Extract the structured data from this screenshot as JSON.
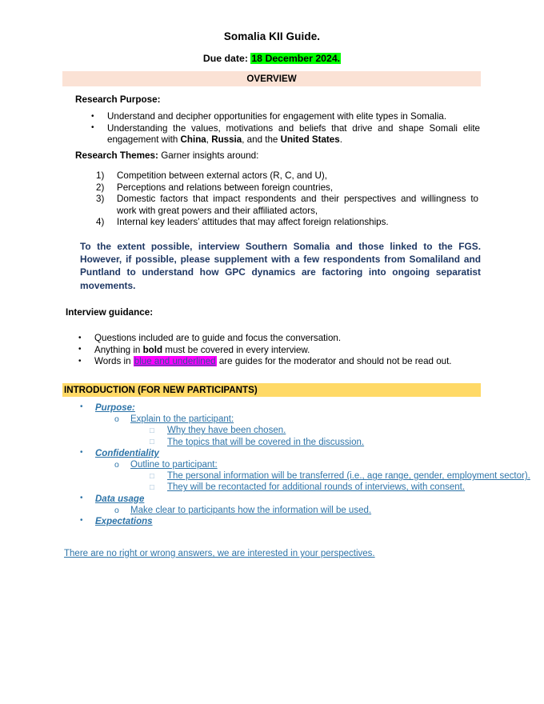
{
  "document": {
    "title": "Somalia KII Guide.",
    "due_label": "Due date:",
    "due_date": "18 December 2024.",
    "colors": {
      "overview_band_bg": "#fbe2d5",
      "intro_band_bg": "#ffd966",
      "green_highlight": "#00ff00",
      "magenta_highlight": "#ff00ff",
      "navy_text": "#1f3864",
      "blue_text": "#2e74a8"
    }
  },
  "overview": {
    "band_label": "OVERVIEW",
    "research_purpose_label": "Research Purpose:",
    "purpose_bullets": [
      "Understand and decipher opportunities for engagement with elite types in Somalia.",
      "Understanding the values, motivations and beliefs that drive and shape Somali elite engagement with China, Russia, and the United States."
    ],
    "purpose_bullet_2_parts": {
      "lead": "Understanding the values, motivations and beliefs that drive and shape Somali elite engagement with ",
      "bold_1": "China",
      "sep_1": ", ",
      "bold_2": "Russia",
      "sep_2": ", and the ",
      "bold_3": "United States",
      "tail": "."
    },
    "research_themes_label": "Research Themes:",
    "research_themes_lead": " Garner insights around:",
    "themes": [
      "Competition between external actors (R, C, and U),",
      "Perceptions and relations between foreign countries,",
      "Domestic factors that impact respondents and their perspectives and willingness to work with great powers and their affiliated actors,",
      "Internal key leaders’ attitudes that may affect foreign relationships."
    ]
  },
  "sampling_note": {
    "line_1": "To the extent possible, interview Southern Somalia and those linked to the FGS.",
    "line_2": "However, if possible, please supplement with a few respondents from Somaliland and Puntland to understand how GPC dynamics are factoring into ongoing separatist movements."
  },
  "interview_guidance": {
    "heading": "Interview guidance:",
    "bullets": [
      {
        "parts": [
          {
            "text": "Questions included are to guide and focus the conversation.",
            "style": "normal"
          }
        ]
      },
      {
        "parts": [
          {
            "text": "Anything in ",
            "style": "normal"
          },
          {
            "text": "bold",
            "style": "bold"
          },
          {
            "text": " must be covered in every interview.",
            "style": "normal"
          }
        ]
      },
      {
        "parts": [
          {
            "text": "Words in ",
            "style": "normal"
          },
          {
            "text": "blue and underlined",
            "style": "magenta-highlight"
          },
          {
            "text": " are guides for the moderator and should not be read out.",
            "style": "normal"
          }
        ]
      }
    ]
  },
  "introduction": {
    "band_label": "INTRODUCTION (FOR NEW PARTICIPANTS)",
    "sections": [
      {
        "heading": "Purpose:",
        "sub": [
          {
            "text": "Explain to the participant:",
            "items": [
              "Why they have been chosen.",
              "The topics that will be covered in the discussion."
            ]
          }
        ]
      },
      {
        "heading": "Confidentiality",
        "sub": [
          {
            "text": "Outline to participant:",
            "items": [
              "The personal information will be transferred (i.e., age range, gender, employment sector).",
              "They will be recontacted for additional rounds of interviews, with consent."
            ]
          }
        ]
      },
      {
        "heading": "Data usage",
        "sub": [
          {
            "text": "Make clear to participants how the information will be used.",
            "items": []
          }
        ]
      },
      {
        "heading": "Expectations",
        "sub": []
      }
    ],
    "closing_line": "There are no right or wrong answers, we are interested in your perspectives."
  }
}
